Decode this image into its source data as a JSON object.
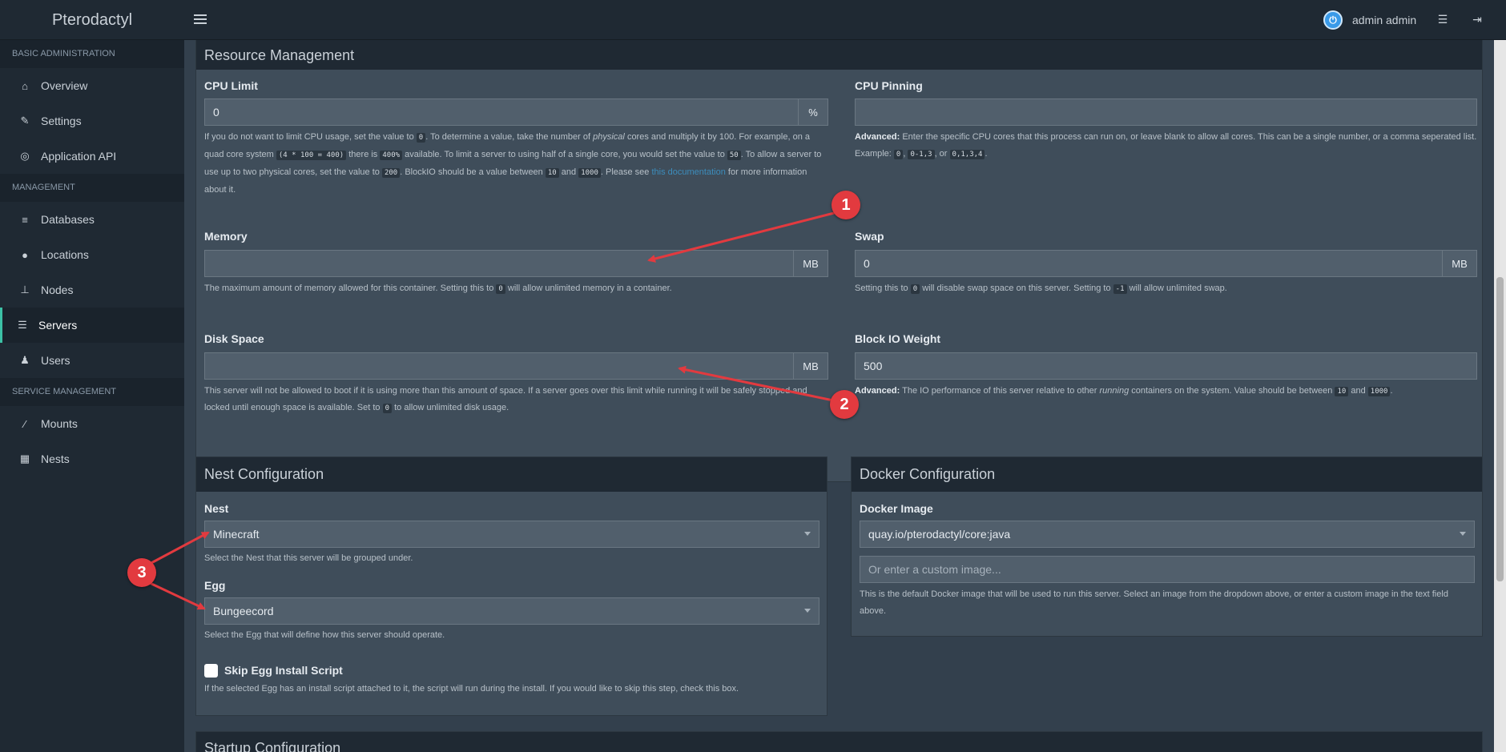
{
  "app": {
    "brand": "Pterodactyl"
  },
  "user": {
    "name": "admin admin"
  },
  "sidebar": {
    "sections": [
      {
        "header": "BASIC ADMINISTRATION",
        "items": [
          {
            "label": "Overview",
            "icon": "home-icon"
          },
          {
            "label": "Settings",
            "icon": "wrench-icon"
          },
          {
            "label": "Application API",
            "icon": "gamepad-icon"
          }
        ]
      },
      {
        "header": "MANAGEMENT",
        "items": [
          {
            "label": "Databases",
            "icon": "database-icon"
          },
          {
            "label": "Locations",
            "icon": "globe-icon"
          },
          {
            "label": "Nodes",
            "icon": "sitemap-icon"
          },
          {
            "label": "Servers",
            "icon": "server-icon",
            "active": true
          },
          {
            "label": "Users",
            "icon": "users-icon"
          }
        ]
      },
      {
        "header": "SERVICE MANAGEMENT",
        "items": [
          {
            "label": "Mounts",
            "icon": "magic-icon"
          },
          {
            "label": "Nests",
            "icon": "th-large-icon"
          }
        ]
      }
    ]
  },
  "resource": {
    "title": "Resource Management",
    "cpu_limit": {
      "label": "CPU Limit",
      "value": "0",
      "addon": "%"
    },
    "cpu_pinning": {
      "label": "CPU Pinning",
      "value": ""
    },
    "memory": {
      "label": "Memory",
      "value": "",
      "addon": "MB",
      "help_a": "The maximum amount of memory allowed for this container. Setting this to",
      "help_code": "0",
      "help_b": "will allow unlimited memory in a container."
    },
    "swap": {
      "label": "Swap",
      "value": "0",
      "addon": "MB",
      "help_a": "Setting this to",
      "help_code1": "0",
      "help_b": "will disable swap space on this server. Setting to",
      "help_code2": "-1",
      "help_c": "will allow unlimited swap."
    },
    "disk": {
      "label": "Disk Space",
      "value": "",
      "addon": "MB",
      "help_a": "This server will not be allowed to boot if it is using more than this amount of space. If a server goes over this limit while running it will be safely stopped and locked until enough space is available. Set to",
      "help_code": "0",
      "help_b": "to allow unlimited disk usage."
    },
    "blockio": {
      "label": "Block IO Weight",
      "value": "500",
      "help_strong": "Advanced:",
      "help_a": "The IO performance of this server relative to other",
      "help_em": "running",
      "help_b": "containers on the system. Value should be between",
      "help_code1": "10",
      "help_and": "and",
      "help_code2": "1000",
      "help_c": "."
    }
  },
  "cpu_help": {
    "t1": "If you do not want to limit CPU usage, set the value to",
    "c1": "0",
    "t2": ". To determine a value, take the number of",
    "em": "physical",
    "t3": "cores and multiply it by 100. For example, on a quad core system",
    "c2": "(4 * 100 = 400)",
    "t4": "there is",
    "c3": "400%",
    "t5": "available. To limit a server to using half of a single core, you would set the value to",
    "c4": "50",
    "t6": ". To allow a server to use up to two physical cores, set the value to",
    "c5": "200",
    "t7": ". BlockIO should be a value between",
    "c6": "10",
    "t8": "and",
    "c7": "1000",
    "t9": ". Please see",
    "link": "this documentation",
    "t10": "for more information about it."
  },
  "pin_help": {
    "strong": "Advanced:",
    "t1": "Enter the specific CPU cores that this process can run on, or leave blank to allow all cores. This can be a single number, or a comma seperated list. Example:",
    "c1": "0",
    "sep1": ",",
    "c2": "0-1,3",
    "sep2": ", or",
    "c3": "0,1,3,4",
    "end": "."
  },
  "nest": {
    "title": "Nest Configuration",
    "nest_label": "Nest",
    "nest_value": "Minecraft",
    "nest_help": "Select the Nest that this server will be grouped under.",
    "egg_label": "Egg",
    "egg_value": "Bungeecord",
    "egg_help": "Select the Egg that will define how this server should operate.",
    "skip_label": "Skip Egg Install Script",
    "skip_help": "If the selected Egg has an install script attached to it, the script will run during the install. If you would like to skip this step, check this box."
  },
  "docker": {
    "title": "Docker Configuration",
    "image_label": "Docker Image",
    "image_value": "quay.io/pterodactyl/core:java",
    "custom_placeholder": "Or enter a custom image...",
    "help": "This is the default Docker image that will be used to run this server. Select an image from the dropdown above, or enter a custom image in the text field above."
  },
  "startup": {
    "title": "Startup Configuration"
  },
  "annotations": {
    "m1": "1",
    "m2": "2",
    "m3": "3",
    "color": "#e23a3f"
  }
}
